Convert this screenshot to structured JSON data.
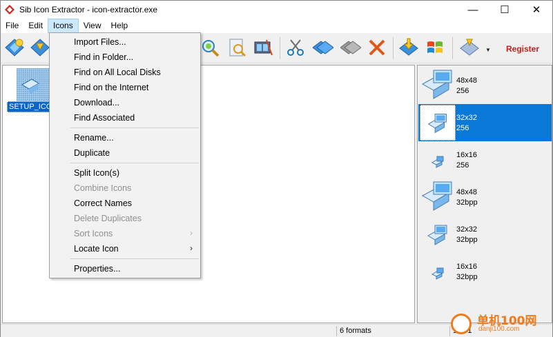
{
  "window": {
    "title": "Sib Icon Extractor - icon-extractor.exe",
    "minimize": "—",
    "maximize": "☐",
    "close": "✕"
  },
  "menubar": {
    "items": [
      {
        "label": "File"
      },
      {
        "label": "Edit"
      },
      {
        "label": "Icons"
      },
      {
        "label": "View"
      },
      {
        "label": "Help"
      }
    ]
  },
  "toolbar": {
    "register_label": "Register",
    "dropdown_arrow": "▼"
  },
  "icons_menu": {
    "items": [
      {
        "label": "Import Files...",
        "enabled": true
      },
      {
        "label": "Find in Folder...",
        "enabled": true
      },
      {
        "label": "Find on All Local Disks",
        "enabled": true
      },
      {
        "label": "Find on the Internet",
        "enabled": true
      },
      {
        "label": "Download...",
        "enabled": true
      },
      {
        "label": "Find Associated",
        "enabled": true
      },
      {
        "label": "Rename...",
        "enabled": true
      },
      {
        "label": "Duplicate",
        "enabled": true
      },
      {
        "label": "Split Icon(s)",
        "enabled": true
      },
      {
        "label": "Combine Icons",
        "enabled": false
      },
      {
        "label": "Correct Names",
        "enabled": true
      },
      {
        "label": "Delete Duplicates",
        "enabled": false
      },
      {
        "label": "Sort Icons",
        "enabled": false,
        "submenu": "›"
      },
      {
        "label": "Locate Icon",
        "enabled": true,
        "submenu": "›"
      },
      {
        "label": "Properties...",
        "enabled": true
      }
    ]
  },
  "file_list": {
    "items": [
      {
        "label": "SETUP_ICO"
      }
    ]
  },
  "formats": [
    {
      "size": "48x48",
      "bits": "256"
    },
    {
      "size": "32x32",
      "bits": "256",
      "selected": true
    },
    {
      "size": "16x16",
      "bits": "256"
    },
    {
      "size": "48x48",
      "bits": "32bpp"
    },
    {
      "size": "32x32",
      "bits": "32bpp"
    },
    {
      "size": "16x16",
      "bits": "32bpp"
    }
  ],
  "status": {
    "formats": "6 formats",
    "position": "1 of 1"
  },
  "watermark": {
    "text": "单机100网",
    "url": "danji100.com"
  },
  "colors": {
    "selection": "#0a78d7",
    "register": "#cc1a1a",
    "menu_highlight": "#cce8ff"
  }
}
